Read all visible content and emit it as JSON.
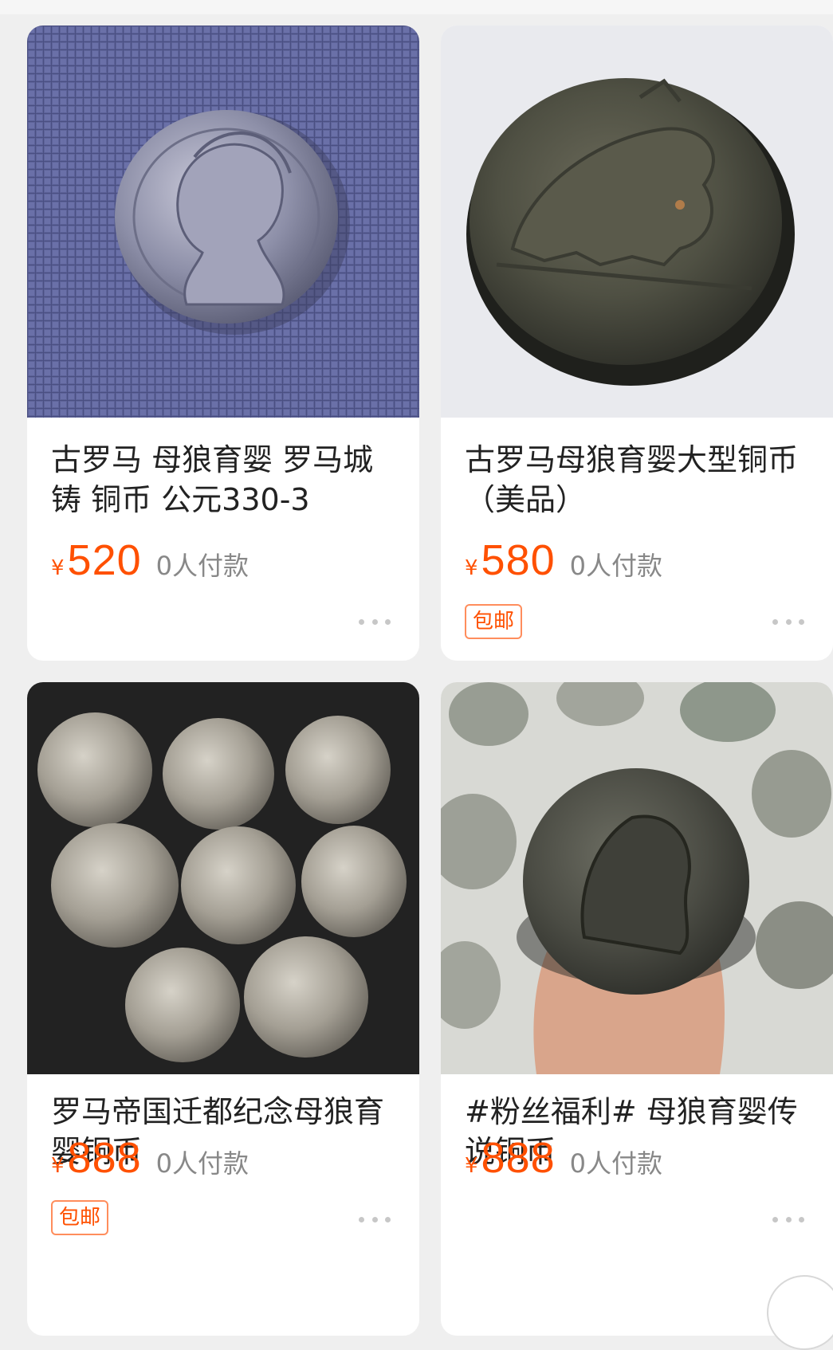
{
  "products": [
    {
      "title": "古罗马 母狼育婴 罗马城铸 铜币 公元330-3",
      "currency": "¥",
      "price": "520",
      "paid": "0人付款",
      "badge": "",
      "image": "single-silver-coin-on-grid-background"
    },
    {
      "title": "古罗马母狼育婴大型铜币（美品）",
      "currency": "¥",
      "price": "580",
      "paid": "0人付款",
      "badge": "包邮",
      "image": "dark-bronze-coin-she-wolf"
    },
    {
      "title": "罗马帝国迁都纪念母狼育婴铜币",
      "currency": "¥",
      "price": "888",
      "paid": "0人付款",
      "badge": "包邮",
      "image": "eight-silver-coins-on-black"
    },
    {
      "title": "#粉丝福利# 母狼育婴传说铜币",
      "currency": "¥",
      "price": "888",
      "paid": "0人付款",
      "badge": "",
      "image": "coin-held-on-fingertip"
    }
  ],
  "colors": {
    "price": "#ff5000",
    "background": "#efefef",
    "card": "#ffffff"
  }
}
